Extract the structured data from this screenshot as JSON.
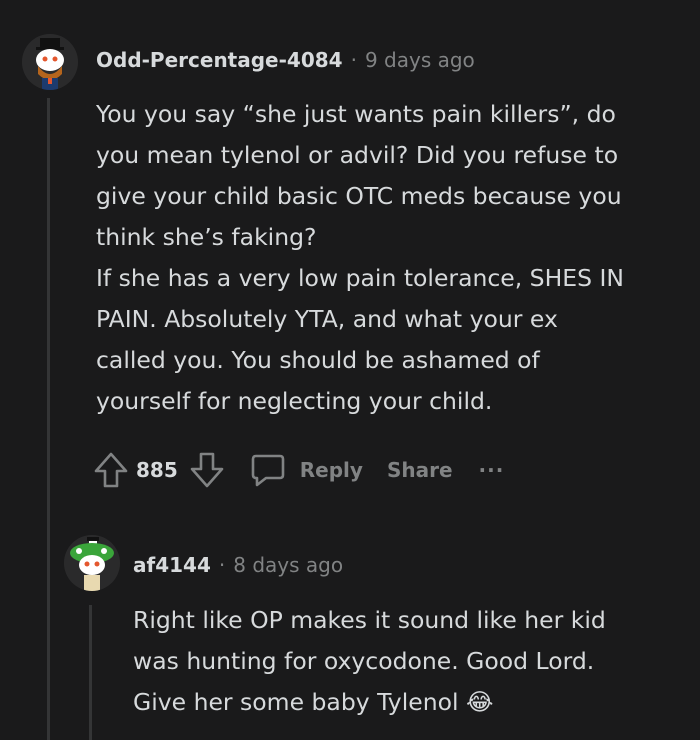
{
  "comment1": {
    "username": "Odd-Percentage-4084",
    "separator": "·",
    "time": "9 days ago",
    "body": "You you say “she just wants pain killers”, do\nyou mean tylenol or advil? Did you refuse to\ngive your child basic OTC meds because you\nthink she’s faking?\nIf she has a very low pain tolerance, SHES IN\nPAIN. Absolutely YTA, and what your ex\ncalled you. You should be ashamed of\nyourself for neglecting your child.",
    "votes": "885",
    "reply_label": "Reply",
    "share_label": "Share",
    "more_label": "···",
    "avatar_icon": "snoo-top-hat-avatar-icon"
  },
  "comment2": {
    "username": "af4144",
    "separator": "·",
    "time": "8 days ago",
    "body": "Right like OP makes it sound like her kid\nwas hunting for oxycodone. Good Lord.\nGive her some baby Tylenol 😂",
    "avatar_icon": "snoo-green-hat-avatar-icon"
  },
  "colors": {
    "background": "#1a1a1b",
    "text": "#d7dadc",
    "muted": "#818384",
    "thread_line": "#343536"
  }
}
